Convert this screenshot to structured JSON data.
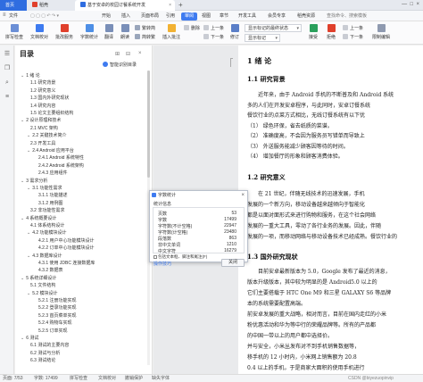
{
  "tabs": [
    {
      "label": "首页"
    },
    {
      "label": "稻壳"
    },
    {
      "label": "基于安卓的校园订餐系统开发"
    }
  ],
  "menu": [
    "文件",
    "开始",
    "插入",
    "页面布局",
    "引用",
    "审阅",
    "视图",
    "章节",
    "开发工具",
    "会员专享",
    "稻壳资源",
    "查找命令、搜索模板"
  ],
  "ribbon": {
    "big_buttons": [
      "拼写检查",
      "文档校对",
      "批改服务",
      "字数统计",
      "翻译",
      "朗读",
      "繁转简",
      "简转繁"
    ],
    "small_buttons": [
      "插入批注",
      "删除",
      "上一条",
      "下一条",
      "修订",
      "显示标记",
      "接受",
      "拒绝",
      "上一条",
      "下一条",
      "限制编辑"
    ],
    "markup_dropdown": "显示标记的最终状态",
    "balloon_dropdown": "显示标记"
  },
  "toc": {
    "heading": "目录",
    "smart_label": "智能识别目录",
    "items": [
      {
        "label": "1 绪  论",
        "level": 1,
        "arrow": "⌄"
      },
      {
        "label": "1.1 研究背景",
        "level": 2,
        "arrow": ""
      },
      {
        "label": "1.2 研究意义",
        "level": 2,
        "arrow": ""
      },
      {
        "label": "1.3 国内外研究现状",
        "level": 2,
        "arrow": ""
      },
      {
        "label": "1.4 研究内容",
        "level": 2,
        "arrow": ""
      },
      {
        "label": "1.5 论文主要组织结构",
        "level": 2,
        "arrow": ""
      },
      {
        "label": "2 设计原理和技术",
        "level": 1,
        "arrow": "⌄"
      },
      {
        "label": "2.1 MVC 架构",
        "level": 2,
        "arrow": ""
      },
      {
        "label": "2.2 关键技术简介",
        "level": 2,
        "arrow": "⌄"
      },
      {
        "label": "2.3 开发工具",
        "level": 2,
        "arrow": ""
      },
      {
        "label": "2.4 Android 应用平台",
        "level": 2,
        "arrow": "⌄"
      },
      {
        "label": "2.4.1 Android 系统特性",
        "level": 3,
        "arrow": ""
      },
      {
        "label": "2.4.2 Android 系统架构",
        "level": 3,
        "arrow": ""
      },
      {
        "label": "2.4.3 应用组件",
        "level": 3,
        "arrow": ""
      },
      {
        "label": "3 需求分析",
        "level": 1,
        "arrow": "⌄"
      },
      {
        "label": "3.1 功能性需求",
        "level": 2,
        "arrow": "⌄"
      },
      {
        "label": "3.1.1 功能描述",
        "level": 3,
        "arrow": ""
      },
      {
        "label": "3.1.2 用例图",
        "level": 3,
        "arrow": ""
      },
      {
        "label": "3.2 非功能性需求",
        "level": 2,
        "arrow": ""
      },
      {
        "label": "4 系统概要设计",
        "level": 1,
        "arrow": "⌄"
      },
      {
        "label": "4.1 体系结构设计",
        "level": 2,
        "arrow": ""
      },
      {
        "label": "4.2 功能模块设计",
        "level": 2,
        "arrow": "⌄"
      },
      {
        "label": "4.2.1 用户中心功能模块设计",
        "level": 3,
        "arrow": ""
      },
      {
        "label": "4.2.2 订单中心功能模块设计",
        "level": 3,
        "arrow": ""
      },
      {
        "label": "4.3 数据库设计",
        "level": 2,
        "arrow": "⌄"
      },
      {
        "label": "4.3.1 使用 JDBC 连接数据库",
        "level": 3,
        "arrow": ""
      },
      {
        "label": "4.3.2 数据表",
        "level": 3,
        "arrow": ""
      },
      {
        "label": "5 系统详细设计",
        "level": 1,
        "arrow": "⌄"
      },
      {
        "label": "5.1 文件结构",
        "level": 2,
        "arrow": ""
      },
      {
        "label": "5.2 模块设计",
        "level": 2,
        "arrow": "⌄"
      },
      {
        "label": "5.2.1 注册功能实现",
        "level": 3,
        "arrow": ""
      },
      {
        "label": "5.2.2 登录功能实现",
        "level": 3,
        "arrow": ""
      },
      {
        "label": "5.2.3 首页菜单实现",
        "level": 3,
        "arrow": ""
      },
      {
        "label": "5.2.4 购物车实现",
        "level": 3,
        "arrow": ""
      },
      {
        "label": "5.2.5 订单实现",
        "level": 3,
        "arrow": ""
      },
      {
        "label": "6 测试",
        "level": 1,
        "arrow": "⌄"
      },
      {
        "label": "6.1 测试的主要内容",
        "level": 2,
        "arrow": ""
      },
      {
        "label": "6.2 测试与分析",
        "level": 2,
        "arrow": ""
      },
      {
        "label": "6.3 测试结论",
        "level": 2,
        "arrow": ""
      }
    ]
  },
  "doc": {
    "h1": "1  绪  论",
    "s1": "1.1  研究背景",
    "p1": [
      "近年来，由于 Android 手机的不断普及和 Android 系统",
      "多的人们在开发安卓程序，与此同时，安卓订餐系统",
      "餐饮行业的点菜方式相比，无线订餐系统有以下优",
      "（1）  绿色环保，省去纸质的菜谱。",
      "（2）  准确度高，不会因为服务员写错单而导致上",
      "（3）  外送服务能减少顾客因等待的时间。",
      "（4）  增加餐厅的形象和顾客消费体验。"
    ],
    "s2": "1.2  研究意义",
    "p2": [
      "在 21 世纪，伴随无线技术的迅速发展，手机",
      "发展的一个新方向，移动设备越来越倾向于智能化",
      "都是以面对面形式来进行购物和服务，在这个社会网络",
      "发展的一重大工具，零动了各行业务的发展。因此，伴随",
      "发展的一项，而移动网络与移动设备技术已经成熟。餐饮行业的"
    ],
    "s3": "1.3  国外研究现状",
    "p3": [
      "目前安卓最新版本为 5.0，Google 发布了最近的消息，",
      "版本升级版本，其中较为明显的是 Android5.0 以上的",
      "它们主要搭载于 HTC One M9 和三星 GALAXY S6 等品牌",
      "本的系统需要配置高端。",
      "前安卓发展的重大战略，相对而言，目前在国内走红的小米",
      "粉优惠活动和华为等中行的荣耀品牌等。所有的产品都",
      "的中国一带以上的用户都中选择价。",
      "并与安全，小米丛发布对不到手机销售数据等，",
      "移手机的 12 小时内，小米网上销售额为 20.8",
      "0.4 以上的手机，于是商家大面积的使用手机进行"
    ]
  },
  "dialog": {
    "title": "字数统计",
    "close": "×",
    "section": "统计信息",
    "stats": [
      {
        "label": "页数",
        "value": "53"
      },
      {
        "label": "字数",
        "value": "17499"
      },
      {
        "label": "字符数(不计空格)",
        "value": "22947"
      },
      {
        "label": "字符数(计空格)",
        "value": "23480"
      },
      {
        "label": "段落数",
        "value": "863"
      },
      {
        "label": "非中文单词",
        "value": "1210"
      },
      {
        "label": "中文字符",
        "value": "16279"
      }
    ],
    "checkbox_label": "包括文本框、脚注和尾注(F)",
    "tip": "操作技巧",
    "ok": "关闭"
  },
  "status": {
    "page": "页面: 7/53",
    "words": "字数: 17499",
    "spell": "拼写检查",
    "proof": "文档校对",
    "tip": "撤销保护",
    "missing_font": "缺失字体",
    "watermark": "CSDN @biyezuopinvip"
  },
  "colors": {
    "accent": "#3e7bf0",
    "tab_icon_blue": "#2f6de0",
    "tab_icon_red": "#e0402c",
    "tab_icon_green": "#2aa05c"
  }
}
